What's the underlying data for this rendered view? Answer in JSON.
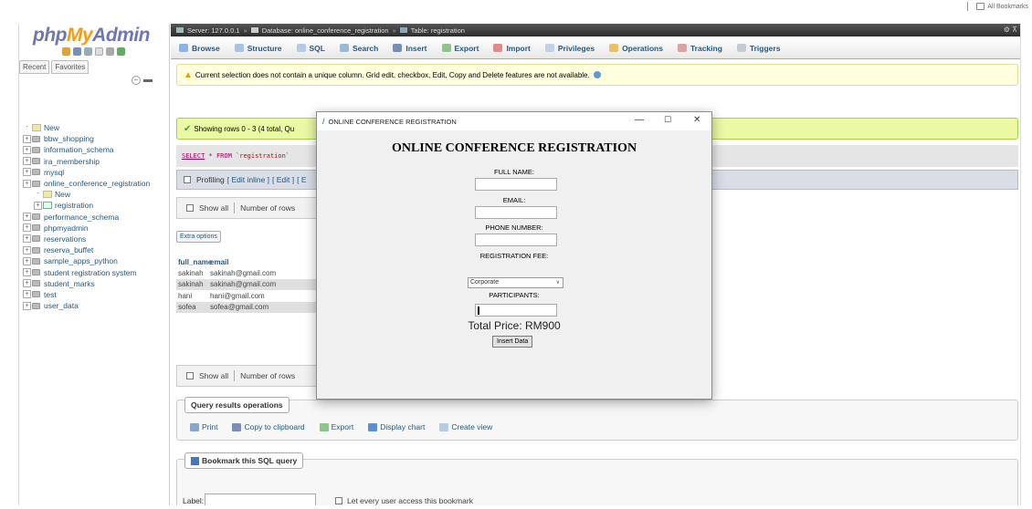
{
  "browser": {
    "bookmarks_label": "All Bookmarks"
  },
  "nav": {
    "logo": {
      "php": "php",
      "my": "My",
      "admin": "Admin"
    },
    "tabs": [
      "Recent",
      "Favorites"
    ],
    "tree": [
      {
        "label": "New",
        "kind": "new",
        "level": 0
      },
      {
        "label": "bbw_shopping",
        "kind": "db",
        "level": 0
      },
      {
        "label": "information_schema",
        "kind": "db",
        "level": 0
      },
      {
        "label": "ira_membership",
        "kind": "db",
        "level": 0
      },
      {
        "label": "mysql",
        "kind": "db",
        "level": 0
      },
      {
        "label": "online_conference_registration",
        "kind": "db",
        "level": 0
      },
      {
        "label": "New",
        "kind": "new",
        "level": 1
      },
      {
        "label": "registration",
        "kind": "table",
        "level": 1
      },
      {
        "label": "performance_schema",
        "kind": "db",
        "level": 0
      },
      {
        "label": "phpmyadmin",
        "kind": "db",
        "level": 0
      },
      {
        "label": "reservations",
        "kind": "db",
        "level": 0
      },
      {
        "label": "reserva_buffet",
        "kind": "db",
        "level": 0
      },
      {
        "label": "sample_apps_python",
        "kind": "db",
        "level": 0
      },
      {
        "label": "student registration system",
        "kind": "db",
        "level": 0
      },
      {
        "label": "student_marks",
        "kind": "db",
        "level": 0
      },
      {
        "label": "test",
        "kind": "db",
        "level": 0
      },
      {
        "label": "user_data",
        "kind": "db",
        "level": 0
      }
    ]
  },
  "breadcrumb": {
    "server": "Server: 127.0.0.1",
    "database": "Database: online_conference_registration",
    "table": "Table: registration"
  },
  "tabs": [
    {
      "label": "Browse",
      "color": "#8ab4e0"
    },
    {
      "label": "Structure",
      "color": "#a9c4de"
    },
    {
      "label": "SQL",
      "color": "#b7c9e6"
    },
    {
      "label": "Search",
      "color": "#9bb9d4"
    },
    {
      "label": "Insert",
      "color": "#7b8fb6"
    },
    {
      "label": "Export",
      "color": "#8fc48f"
    },
    {
      "label": "Import",
      "color": "#e08a8a"
    },
    {
      "label": "Privileges",
      "color": "#c2d2e6"
    },
    {
      "label": "Operations",
      "color": "#e8c36b"
    },
    {
      "label": "Tracking",
      "color": "#d8a3a3"
    },
    {
      "label": "Triggers",
      "color": "#c6cbd3"
    }
  ],
  "notice": "Current selection does not contain a unique column. Grid edit, checkbox, Edit, Copy and Delete features are not available.",
  "success": "Showing rows 0 - 3 (4 total, Qu",
  "sql": {
    "kw": "SELECT",
    "rest": " * FROM ",
    "str": "`registration`"
  },
  "profiling": {
    "label": "Profiling",
    "links": [
      "[ Edit inline ]",
      "[ Edit ]",
      "[ E"
    ]
  },
  "table_nav": {
    "show_all": "Show all",
    "rows_label": "Number of rows"
  },
  "extra_options": "Extra options",
  "results": {
    "columns": [
      "full_name",
      "email"
    ],
    "rows": [
      [
        "sakinah",
        "sakinah@gmail.com"
      ],
      [
        "sakinah",
        "sakinah@gmail.com"
      ],
      [
        "hani",
        "hani@gmail.com"
      ],
      [
        "sofea",
        "sofea@gmail.com"
      ]
    ]
  },
  "qro": {
    "title": "Query results operations",
    "buttons": [
      "Print",
      "Copy to clipboard",
      "Export",
      "Display chart",
      "Create view"
    ]
  },
  "bookmark": {
    "title": "Bookmark this SQL query",
    "label": "Label:",
    "checkbox": "Let every user access this bookmark"
  },
  "dialog": {
    "window_title": "ONLINE CONFERENCE REGISTRATION",
    "heading": "ONLINE CONFERENCE REGISTRATION",
    "full_name": "FULL NAME:",
    "email": "EMAIL:",
    "phone": "PHONE NUMBER:",
    "fee": "REGISTRATION FEE:",
    "fee_value": "Corporate",
    "participants": "PARTICIPANTS:",
    "total": "Total Price: RM900",
    "button": "Insert Data"
  }
}
